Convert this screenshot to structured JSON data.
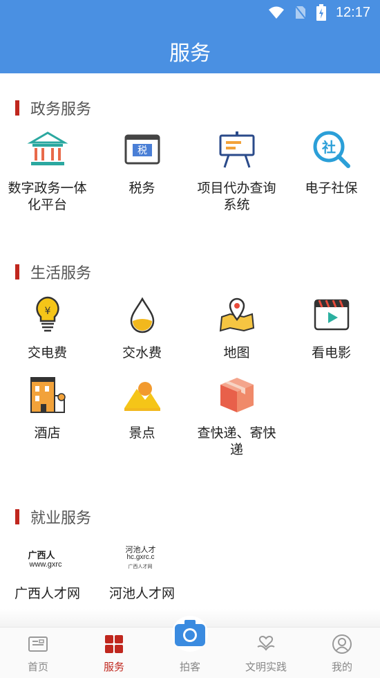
{
  "status_bar": {
    "time": "12:17"
  },
  "header": {
    "title": "服务"
  },
  "sections": [
    {
      "title": "政务服务",
      "items": [
        {
          "label": "数字政务一体化平台",
          "icon": "government-building-icon"
        },
        {
          "label": "税务",
          "icon": "tax-icon"
        },
        {
          "label": "项目代办查询系统",
          "icon": "easel-board-icon"
        },
        {
          "label": "电子社保",
          "icon": "social-security-search-icon"
        }
      ]
    },
    {
      "title": "生活服务",
      "items": [
        {
          "label": "交电费",
          "icon": "lightbulb-icon"
        },
        {
          "label": "交水费",
          "icon": "water-drop-icon"
        },
        {
          "label": "地图",
          "icon": "map-pin-icon"
        },
        {
          "label": "看电影",
          "icon": "movie-clapper-icon"
        },
        {
          "label": "酒店",
          "icon": "hotel-building-icon"
        },
        {
          "label": "景点",
          "icon": "scenery-mountain-icon"
        },
        {
          "label": "查快递、寄快递",
          "icon": "package-box-icon"
        }
      ]
    },
    {
      "title": "就业服务",
      "items": [
        {
          "label": "广西人才网",
          "logo_text": "广西人",
          "logo_sub": "www.gxrc"
        },
        {
          "label": "河池人才网",
          "logo_text": "河池人才",
          "logo_sub": "hc.gxrc.c",
          "logo_sub2": "广西人才网"
        }
      ]
    }
  ],
  "tabbar": {
    "tabs": [
      {
        "label": "首页",
        "icon": "newspaper-icon",
        "active": false
      },
      {
        "label": "服务",
        "icon": "grid-squares-icon",
        "active": true
      },
      {
        "label": "拍客",
        "icon": "camera-icon",
        "active": false
      },
      {
        "label": "文明实践",
        "icon": "hands-heart-icon",
        "active": false
      },
      {
        "label": "我的",
        "icon": "user-profile-icon",
        "active": false
      }
    ]
  },
  "colors": {
    "header_blue": "#4a90e2",
    "accent_red": "#c0271e"
  }
}
